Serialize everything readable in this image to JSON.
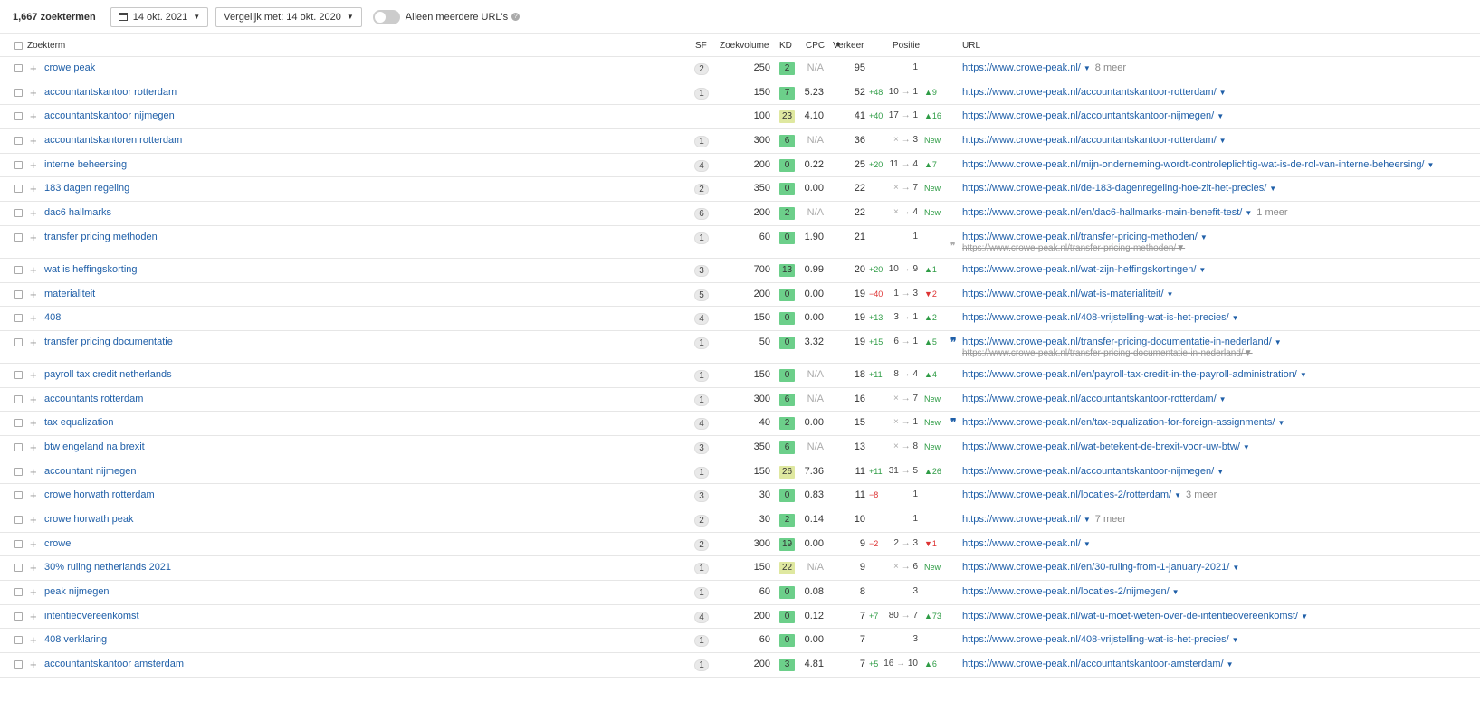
{
  "toolbar": {
    "count_num": "1,667",
    "count_label": "zoektermen",
    "date": "14 okt. 2021",
    "compare": "Vergelijk met: 14 okt. 2020",
    "toggle_label": "Alleen meerdere URL's"
  },
  "headers": {
    "keyword": "Zoekterm",
    "sf": "SF",
    "volume": "Zoekvolume",
    "kd": "KD",
    "cpc": "CPC",
    "traffic": "Verkeer",
    "position": "Positie",
    "url": "URL"
  },
  "rows": [
    {
      "kw": "crowe peak",
      "sf": "2",
      "vol": "250",
      "kd": "2",
      "kdc": "g",
      "cpc": "N/A",
      "traf": "95",
      "tchg": "",
      "pf": "",
      "pt": "1",
      "pchg": "",
      "url": "https://www.crowe-peak.nl/",
      "more": "8 meer"
    },
    {
      "kw": "accountantskantoor rotterdam",
      "sf": "1",
      "vol": "150",
      "kd": "7",
      "kdc": "g",
      "cpc": "5.23",
      "traf": "52",
      "tchg": "+48",
      "pf": "10",
      "pt": "1",
      "pchg": "▲9",
      "url": "https://www.crowe-peak.nl/accountantskantoor-rotterdam/",
      "more": ""
    },
    {
      "kw": "accountantskantoor nijmegen",
      "sf": "",
      "vol": "100",
      "kd": "23",
      "kdc": "y",
      "cpc": "4.10",
      "traf": "41",
      "tchg": "+40",
      "pf": "17",
      "pt": "1",
      "pchg": "▲16",
      "url": "https://www.crowe-peak.nl/accountantskantoor-nijmegen/",
      "more": ""
    },
    {
      "kw": "accountantskantoren rotterdam",
      "sf": "1",
      "vol": "300",
      "kd": "6",
      "kdc": "g",
      "cpc": "N/A",
      "traf": "36",
      "tchg": "",
      "pf": "×",
      "pt": "3",
      "pchg": "New",
      "url": "https://www.crowe-peak.nl/accountantskantoor-rotterdam/",
      "more": ""
    },
    {
      "kw": "interne beheersing",
      "sf": "4",
      "vol": "200",
      "kd": "0",
      "kdc": "g",
      "cpc": "0.22",
      "traf": "25",
      "tchg": "+20",
      "pf": "11",
      "pt": "4",
      "pchg": "▲7",
      "url": "https://www.crowe-peak.nl/mijn-onderneming-wordt-controleplichtig-wat-is-de-rol-van-interne-beheersing/",
      "more": ""
    },
    {
      "kw": "183 dagen regeling",
      "sf": "2",
      "vol": "350",
      "kd": "0",
      "kdc": "g",
      "cpc": "0.00",
      "traf": "22",
      "tchg": "",
      "pf": "×",
      "pt": "7",
      "pchg": "New",
      "url": "https://www.crowe-peak.nl/de-183-dagenregeling-hoe-zit-het-precies/",
      "more": ""
    },
    {
      "kw": "dac6 hallmarks",
      "sf": "6",
      "vol": "200",
      "kd": "2",
      "kdc": "g",
      "cpc": "N/A",
      "traf": "22",
      "tchg": "",
      "pf": "×",
      "pt": "4",
      "pchg": "New",
      "url": "https://www.crowe-peak.nl/en/dac6-hallmarks-main-benefit-test/",
      "more": "1 meer"
    },
    {
      "kw": "transfer pricing methoden",
      "sf": "1",
      "vol": "60",
      "kd": "0",
      "kdc": "g",
      "cpc": "1.90",
      "traf": "21",
      "tchg": "",
      "pf": "",
      "pt": "1",
      "pchg": "",
      "url": "https://www.crowe-peak.nl/transfer-pricing-methoden/",
      "more": "",
      "url2": "https://www.crowe-peak.nl/transfer-pricing-methoden/",
      "quote2": true,
      "tall": true
    },
    {
      "kw": "wat is heffingskorting",
      "sf": "3",
      "vol": "700",
      "kd": "13",
      "kdc": "g",
      "cpc": "0.99",
      "traf": "20",
      "tchg": "+20",
      "pf": "10",
      "pt": "9",
      "pchg": "▲1",
      "url": "https://www.crowe-peak.nl/wat-zijn-heffingskortingen/",
      "more": ""
    },
    {
      "kw": "materialiteit",
      "sf": "5",
      "vol": "200",
      "kd": "0",
      "kdc": "g",
      "cpc": "0.00",
      "traf": "19",
      "tchg": "−40",
      "pf": "1",
      "pt": "3",
      "pchg": "▼2",
      "url": "https://www.crowe-peak.nl/wat-is-materialiteit/",
      "more": ""
    },
    {
      "kw": "408",
      "sf": "4",
      "vol": "150",
      "kd": "0",
      "kdc": "g",
      "cpc": "0.00",
      "traf": "19",
      "tchg": "+13",
      "pf": "3",
      "pt": "1",
      "pchg": "▲2",
      "url": "https://www.crowe-peak.nl/408-vrijstelling-wat-is-het-precies/",
      "more": ""
    },
    {
      "kw": "transfer pricing documentatie",
      "sf": "1",
      "vol": "50",
      "kd": "0",
      "kdc": "g",
      "cpc": "3.32",
      "traf": "19",
      "tchg": "+15",
      "pf": "6",
      "pt": "1",
      "pchg": "▲5",
      "url": "https://www.crowe-peak.nl/transfer-pricing-documentatie-in-nederland/",
      "more": "",
      "url2": "https://www.crowe-peak.nl/transfer-pricing-documentatie-in-nederland/",
      "quote": true,
      "tall": true
    },
    {
      "kw": "payroll tax credit netherlands",
      "sf": "1",
      "vol": "150",
      "kd": "0",
      "kdc": "g",
      "cpc": "N/A",
      "traf": "18",
      "tchg": "+11",
      "pf": "8",
      "pt": "4",
      "pchg": "▲4",
      "url": "https://www.crowe-peak.nl/en/payroll-tax-credit-in-the-payroll-administration/",
      "more": ""
    },
    {
      "kw": "accountants rotterdam",
      "sf": "1",
      "vol": "300",
      "kd": "6",
      "kdc": "g",
      "cpc": "N/A",
      "traf": "16",
      "tchg": "",
      "pf": "×",
      "pt": "7",
      "pchg": "New",
      "url": "https://www.crowe-peak.nl/accountantskantoor-rotterdam/",
      "more": ""
    },
    {
      "kw": "tax equalization",
      "sf": "4",
      "vol": "40",
      "kd": "2",
      "kdc": "g",
      "cpc": "0.00",
      "traf": "15",
      "tchg": "",
      "pf": "×",
      "pt": "1",
      "pchg": "New",
      "url": "https://www.crowe-peak.nl/en/tax-equalization-for-foreign-assignments/",
      "more": "",
      "quote": true
    },
    {
      "kw": "btw engeland na brexit",
      "sf": "3",
      "vol": "350",
      "kd": "6",
      "kdc": "g",
      "cpc": "N/A",
      "traf": "13",
      "tchg": "",
      "pf": "×",
      "pt": "8",
      "pchg": "New",
      "url": "https://www.crowe-peak.nl/wat-betekent-de-brexit-voor-uw-btw/",
      "more": ""
    },
    {
      "kw": "accountant nijmegen",
      "sf": "1",
      "vol": "150",
      "kd": "26",
      "kdc": "y",
      "cpc": "7.36",
      "traf": "11",
      "tchg": "+11",
      "pf": "31",
      "pt": "5",
      "pchg": "▲26",
      "url": "https://www.crowe-peak.nl/accountantskantoor-nijmegen/",
      "more": ""
    },
    {
      "kw": "crowe horwath rotterdam",
      "sf": "3",
      "vol": "30",
      "kd": "0",
      "kdc": "g",
      "cpc": "0.83",
      "traf": "11",
      "tchg": "−8",
      "pf": "",
      "pt": "1",
      "pchg": "",
      "url": "https://www.crowe-peak.nl/locaties-2/rotterdam/",
      "more": "3 meer"
    },
    {
      "kw": "crowe horwath peak",
      "sf": "2",
      "vol": "30",
      "kd": "2",
      "kdc": "g",
      "cpc": "0.14",
      "traf": "10",
      "tchg": "",
      "pf": "",
      "pt": "1",
      "pchg": "",
      "url": "https://www.crowe-peak.nl/",
      "more": "7 meer"
    },
    {
      "kw": "crowe",
      "sf": "2",
      "vol": "300",
      "kd": "19",
      "kdc": "g",
      "cpc": "0.00",
      "traf": "9",
      "tchg": "−2",
      "pf": "2",
      "pt": "3",
      "pchg": "▼1",
      "url": "https://www.crowe-peak.nl/",
      "more": ""
    },
    {
      "kw": "30% ruling netherlands 2021",
      "sf": "1",
      "vol": "150",
      "kd": "22",
      "kdc": "y",
      "cpc": "N/A",
      "traf": "9",
      "tchg": "",
      "pf": "×",
      "pt": "6",
      "pchg": "New",
      "url": "https://www.crowe-peak.nl/en/30-ruling-from-1-january-2021/",
      "more": ""
    },
    {
      "kw": "peak nijmegen",
      "sf": "1",
      "vol": "60",
      "kd": "0",
      "kdc": "g",
      "cpc": "0.08",
      "traf": "8",
      "tchg": "",
      "pf": "",
      "pt": "3",
      "pchg": "",
      "url": "https://www.crowe-peak.nl/locaties-2/nijmegen/",
      "more": ""
    },
    {
      "kw": "intentieovereenkomst",
      "sf": "4",
      "vol": "200",
      "kd": "0",
      "kdc": "g",
      "cpc": "0.12",
      "traf": "7",
      "tchg": "+7",
      "pf": "80",
      "pt": "7",
      "pchg": "▲73",
      "url": "https://www.crowe-peak.nl/wat-u-moet-weten-over-de-intentieovereenkomst/",
      "more": ""
    },
    {
      "kw": "408 verklaring",
      "sf": "1",
      "vol": "60",
      "kd": "0",
      "kdc": "g",
      "cpc": "0.00",
      "traf": "7",
      "tchg": "",
      "pf": "",
      "pt": "3",
      "pchg": "",
      "url": "https://www.crowe-peak.nl/408-vrijstelling-wat-is-het-precies/",
      "more": ""
    },
    {
      "kw": "accountantskantoor amsterdam",
      "sf": "1",
      "vol": "200",
      "kd": "3",
      "kdc": "g",
      "cpc": "4.81",
      "traf": "7",
      "tchg": "+5",
      "pf": "16",
      "pt": "10",
      "pchg": "▲6",
      "url": "https://www.crowe-peak.nl/accountantskantoor-amsterdam/",
      "more": ""
    }
  ]
}
